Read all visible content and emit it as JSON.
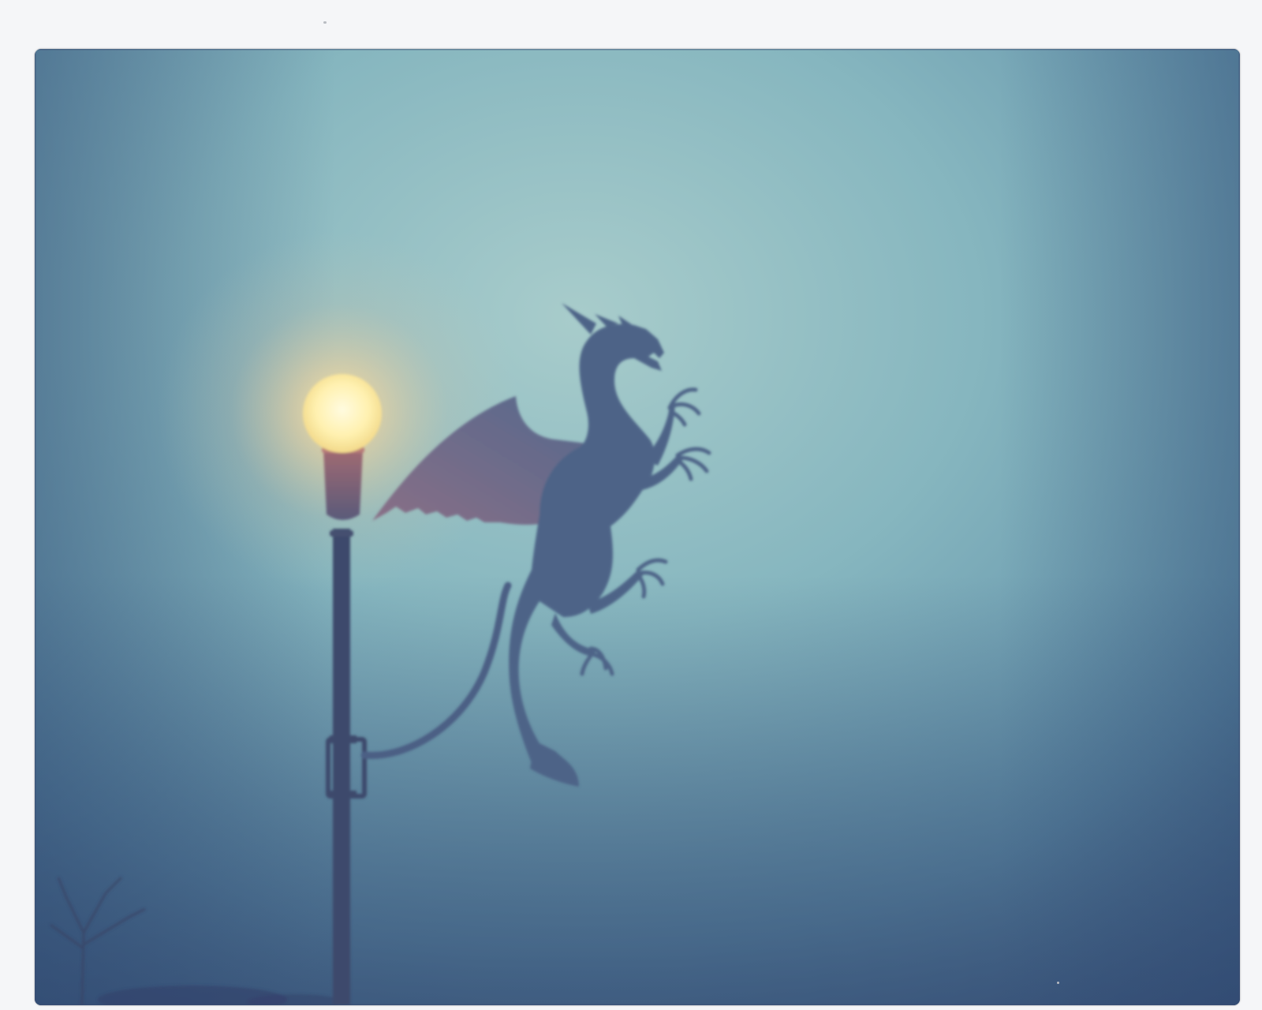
{
  "scene": {
    "subject": "dragon-weathervane-silhouette",
    "colors": {
      "sky_center": "#a9cccd",
      "sky_mid": "#7fb2be",
      "sky_edge": "#3f5f82",
      "lamp_glow": "#fff3b8",
      "lamp_halo": "#f2c98a",
      "silhouette": "#4f6688",
      "pole": "#3c4d6c",
      "frame_border": "#f5f6f8"
    }
  }
}
